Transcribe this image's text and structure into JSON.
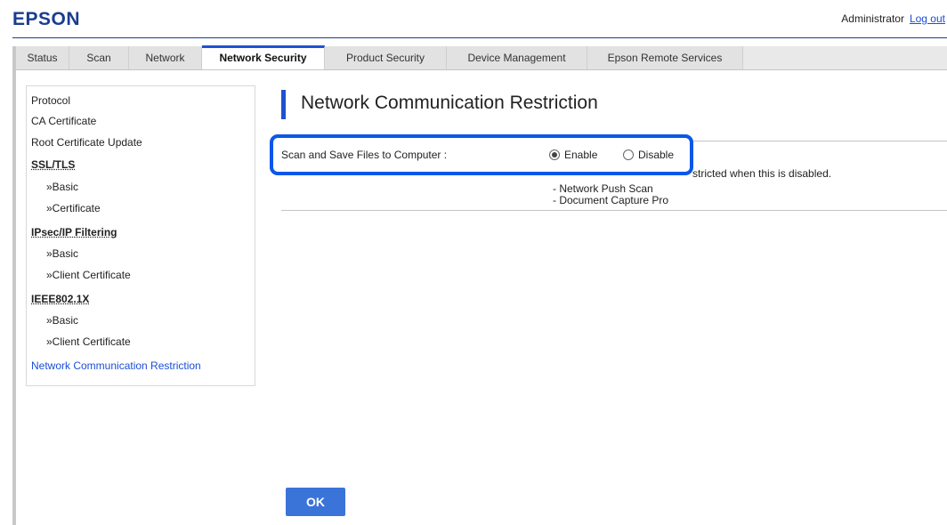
{
  "brand": {
    "logo": "EPSON"
  },
  "header": {
    "user": "Administrator",
    "logout": "Log out"
  },
  "tabs": [
    {
      "label": "Status"
    },
    {
      "label": "Scan"
    },
    {
      "label": "Network"
    },
    {
      "label": "Network Security",
      "active": true
    },
    {
      "label": "Product Security"
    },
    {
      "label": "Device Management"
    },
    {
      "label": "Epson Remote Services"
    }
  ],
  "sidebar": {
    "items": [
      {
        "label": "Protocol"
      },
      {
        "label": "CA Certificate"
      },
      {
        "label": "Root Certificate Update"
      },
      {
        "label": "SSL/TLS"
      },
      {
        "label": "»Basic"
      },
      {
        "label": "»Certificate"
      },
      {
        "label": "IPsec/IP Filtering"
      },
      {
        "label": "»Basic"
      },
      {
        "label": "»Client Certificate"
      },
      {
        "label": "IEEE802.1X"
      },
      {
        "label": "»Basic"
      },
      {
        "label": "»Client Certificate"
      },
      {
        "label": "Network Communication Restriction"
      }
    ]
  },
  "main": {
    "title": "Network Communication Restriction",
    "field_label": "Scan and Save Files to Computer :",
    "options": {
      "enable": "Enable",
      "disable": "Disable",
      "selected": "Enable"
    },
    "note_partial": "stricted when this is disabled.",
    "note_items": [
      "- Network Push Scan",
      "- Document Capture Pro"
    ],
    "ok_label": "OK"
  },
  "colors": {
    "accent": "#1d52d1",
    "highlight": "#0b57e8",
    "link": "#1a4fd6",
    "logo": "#1a3d8f"
  }
}
